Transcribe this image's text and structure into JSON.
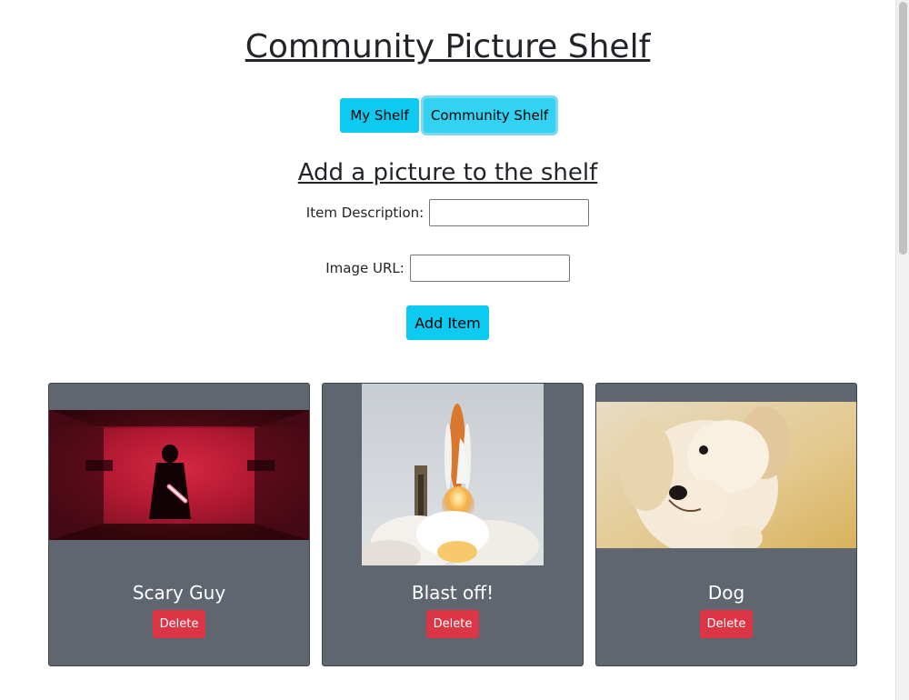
{
  "header": {
    "title": "Community Picture Shelf"
  },
  "nav": {
    "my_shelf_label": "My Shelf",
    "community_shelf_label": "Community Shelf"
  },
  "form": {
    "title": "Add a picture to the shelf",
    "description_label": "Item Description:",
    "description_value": "",
    "url_label": "Image URL:",
    "url_value": "",
    "submit_label": "Add Item"
  },
  "shelf": {
    "items": [
      {
        "caption": "Scary Guy",
        "delete_label": "Delete",
        "image": "dark-figure-red-corridor-photo"
      },
      {
        "caption": "Blast off!",
        "delete_label": "Delete",
        "image": "rocket-launch-photo"
      },
      {
        "caption": "Dog",
        "delete_label": "Delete",
        "image": "puppy-photo"
      }
    ]
  },
  "colors": {
    "info_button": "#0dcaf0",
    "danger_button": "#dc3545",
    "card_background": "#5f6670"
  }
}
